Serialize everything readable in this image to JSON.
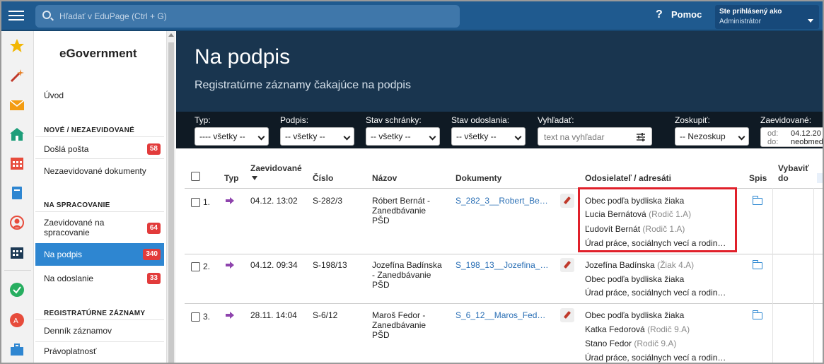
{
  "topbar": {
    "search_placeholder": "Hľadať v EduPage (Ctrl + G)",
    "help_label": "Pomoc",
    "user_line1": "Ste prihlásený ako",
    "user_line2": "Administrátor"
  },
  "sidebar": {
    "brand": "eGovernment",
    "intro": "Úvod",
    "section1": "NOVÉ / NEZAEVIDOVANÉ",
    "item_dosla": "Došlá pošta",
    "badge_dosla": "58",
    "item_nezaev": "Nezaevidované dokumenty",
    "section2": "NA SPRACOVANIE",
    "item_zaev_line1": "Zaevidované na",
    "item_zaev_line2": "spracovanie",
    "badge_zaev": "64",
    "item_podpis": "Na podpis",
    "badge_podpis": "340",
    "item_odoslanie": "Na odoslanie",
    "badge_odoslanie": "33",
    "section3": "REGISTRATÚRNE ZÁZNAMY",
    "item_dennik": "Denník záznamov",
    "item_pravo": "Právoplatnosť"
  },
  "page": {
    "title": "Na podpis",
    "subtitle": "Registratúrne záznamy čakajúce na podpis"
  },
  "filters": {
    "typ_label": "Typ:",
    "typ_value": "---- všetky --",
    "podpis_label": "Podpis:",
    "podpis_value": "-- všetky --",
    "schranka_label": "Stav schránky:",
    "schranka_value": "-- všetky --",
    "odoslania_label": "Stav odoslania:",
    "odoslania_value": "-- všetky --",
    "hladat_label": "Vyhľadať:",
    "hladat_placeholder": "text na vyhľadar",
    "zoskupit_label": "Zoskupiť:",
    "zoskupit_value": "-- Nezoskup",
    "zaev_label": "Zaevidované:",
    "od_label": "od:",
    "od_value": "04.12.20",
    "do_label": "do:",
    "do_value": "neobmed"
  },
  "table": {
    "headers": {
      "typ": "Typ",
      "zaev": "Zaevidované",
      "cislo": "Číslo",
      "nazov": "Názov",
      "dokumenty": "Dokumenty",
      "odosielatel": "Odosielateľ / adresáti",
      "spis": "Spis",
      "vybavit_1": "Vybaviť",
      "vybavit_2": "do"
    },
    "rows": [
      {
        "num": "1.",
        "date": "04.12. 13:02",
        "cislo": "S-282/3",
        "nazov1": "Róbert Bernát -",
        "nazov2": "Zanedbávanie",
        "nazov3": "PŠD",
        "doc": "S_282_3__Robert_Be…",
        "a1": "Obec podľa bydliska žiaka",
        "a2": "Lucia Bernátová",
        "a2m": "(Rodič 1.A)",
        "a3": "Ľudovít Bernát",
        "a3m": "(Rodič 1.A)",
        "a4": "Úrad práce, sociálnych vecí a rodin…"
      },
      {
        "num": "2.",
        "date": "04.12. 09:34",
        "cislo": "S-198/13",
        "nazov1": "Jozefína Badínska",
        "nazov2": "- Zanedbávanie",
        "nazov3": "PŠD",
        "doc": "S_198_13__Jozefina_…",
        "a1": "Jozefína Badínska",
        "a1m": "(Žiak 4.A)",
        "a2": "Obec podľa bydliska žiaka",
        "a3": "Úrad práce, sociálnych vecí a rodin…"
      },
      {
        "num": "3.",
        "date": "28.11. 14:04",
        "cislo": "S-6/12",
        "nazov1": "Maroš Fedor -",
        "nazov2": "Zanedbávanie",
        "nazov3": "PŠD",
        "doc": "S_6_12__Maros_Fed…",
        "a1": "Obec podľa bydliska žiaka",
        "a2": "Katka Fedorová",
        "a2m": "(Rodič 9.A)",
        "a3": "Stano Fedor",
        "a3m": "(Rodič 9.A)",
        "a4": "Úrad práce, sociálnych vecí a rodin…"
      }
    ]
  },
  "colors": {
    "topbar": "#1f5a8f",
    "hero": "#19354f",
    "filterbar": "#0f1a24",
    "active": "#2e86d1",
    "badge": "#e23b3b",
    "highlight": "#e0202a"
  }
}
